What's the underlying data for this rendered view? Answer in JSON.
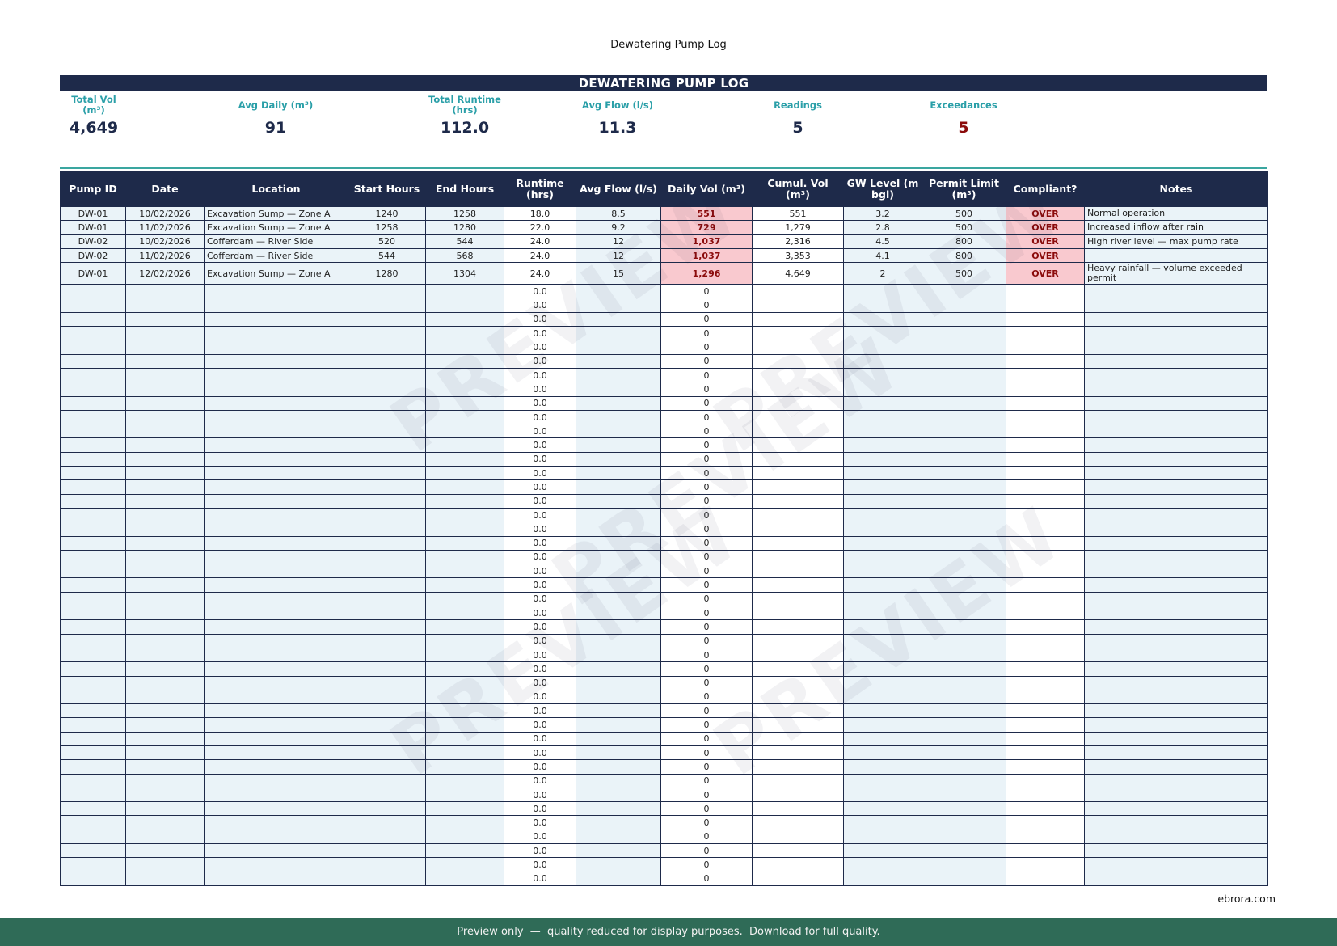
{
  "page_title": "Dewatering Pump Log",
  "banner": "DEWATERING PUMP LOG",
  "kpis": [
    {
      "label": "Total Vol (m³)",
      "value": "4,649",
      "alert": false
    },
    {
      "label": "Avg Daily (m³)",
      "value": "91",
      "alert": false
    },
    {
      "label": "Total Runtime (hrs)",
      "value": "112.0",
      "alert": false
    },
    {
      "label": "Avg Flow (l/s)",
      "value": "11.3",
      "alert": false
    },
    {
      "label": "Readings",
      "value": "5",
      "alert": false
    },
    {
      "label": "Exceedances",
      "value": "5",
      "alert": true
    }
  ],
  "columns": [
    "Pump ID",
    "Date",
    "Location",
    "Start Hours",
    "End Hours",
    "Runtime (hrs)",
    "Avg Flow (l/s)",
    "Daily Vol (m³)",
    "Cumul. Vol (m³)",
    "GW Level (m bgl)",
    "Permit Limit (m³)",
    "Compliant?",
    "Notes"
  ],
  "rows": [
    [
      "DW-01",
      "10/02/2026",
      "Excavation Sump — Zone A",
      "1240",
      "1258",
      "18.0",
      "8.5",
      "551",
      "551",
      "3.2",
      "500",
      "OVER",
      "Normal operation"
    ],
    [
      "DW-01",
      "11/02/2026",
      "Excavation Sump — Zone A",
      "1258",
      "1280",
      "22.0",
      "9.2",
      "729",
      "1,279",
      "2.8",
      "500",
      "OVER",
      "Increased inflow after rain"
    ],
    [
      "DW-02",
      "10/02/2026",
      "Cofferdam — River Side",
      "520",
      "544",
      "24.0",
      "12",
      "1,037",
      "2,316",
      "4.5",
      "800",
      "OVER",
      "High river level — max pump rate"
    ],
    [
      "DW-02",
      "11/02/2026",
      "Cofferdam — River Side",
      "544",
      "568",
      "24.0",
      "12",
      "1,037",
      "3,353",
      "4.1",
      "800",
      "OVER",
      ""
    ],
    [
      "DW-01",
      "12/02/2026",
      "Excavation Sump — Zone A",
      "1280",
      "1304",
      "24.0",
      "15",
      "1,296",
      "4,649",
      "2",
      "500",
      "OVER",
      "Heavy rainfall — volume exceeded permit"
    ]
  ],
  "empty_row": {
    "runtime": "0.0",
    "daily_vol": "0"
  },
  "empty_row_count": 43,
  "watermark_text": "PREVIEW",
  "site_link": "ebrora.com",
  "footer_text": "Preview only  —  quality reduced for display purposes.  Download for full quality.",
  "colors": {
    "navy": "#1e2a4a",
    "teal": "#2a9fa8",
    "tint": "#eaf3f8",
    "over_bg": "#f9c9cf",
    "over_text": "#8b0b0b",
    "footer": "#2f6b57"
  }
}
